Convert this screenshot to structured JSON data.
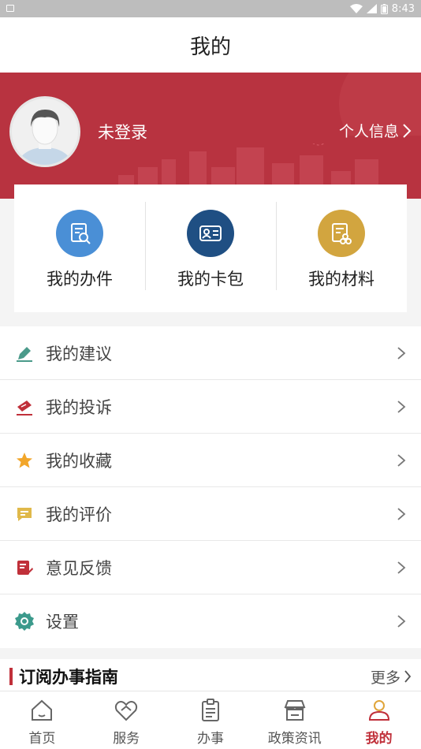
{
  "status_bar": {
    "time": "8:43"
  },
  "header": {
    "title": "我的"
  },
  "profile": {
    "login_status": "未登录",
    "personal_info_link": "个人信息"
  },
  "quick_actions": [
    {
      "label": "我的办件",
      "icon": "document-search-icon",
      "color": "#4a8fd6"
    },
    {
      "label": "我的卡包",
      "icon": "id-card-icon",
      "color": "#1f4f83"
    },
    {
      "label": "我的材料",
      "icon": "materials-icon",
      "color": "#d2a53f"
    }
  ],
  "menu": {
    "items": [
      {
        "label": "我的建议",
        "icon": "pen-edit-icon",
        "color": "#4a9a8a"
      },
      {
        "label": "我的投诉",
        "icon": "complaint-icon",
        "color": "#c0303a"
      },
      {
        "label": "我的收藏",
        "icon": "star-icon",
        "color": "#f2a62a"
      },
      {
        "label": "我的评价",
        "icon": "comment-icon",
        "color": "#e0b94a"
      },
      {
        "label": "意见反馈",
        "icon": "feedback-icon",
        "color": "#c0303a"
      },
      {
        "label": "设置",
        "icon": "gear-icon",
        "color": "#3c9a8c"
      }
    ]
  },
  "guide_section": {
    "title": "订阅办事指南",
    "more_label": "更多"
  },
  "tabbar": {
    "items": [
      {
        "label": "首页",
        "icon": "home-icon"
      },
      {
        "label": "服务",
        "icon": "heart-tag-icon"
      },
      {
        "label": "办事",
        "icon": "clipboard-icon"
      },
      {
        "label": "政策资讯",
        "icon": "store-icon"
      },
      {
        "label": "我的",
        "icon": "user-icon",
        "active": true
      }
    ]
  },
  "colors": {
    "brand_red": "#b83340",
    "active_tab": "#c0303a"
  }
}
